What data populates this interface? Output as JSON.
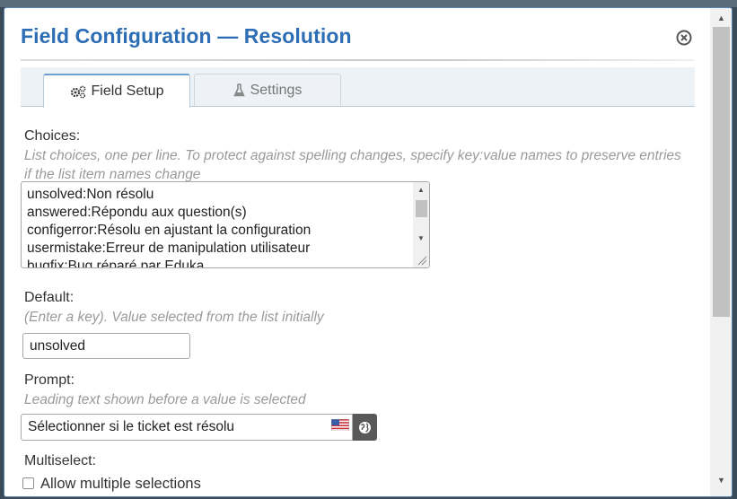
{
  "dialog": {
    "title": "Field Configuration — Resolution"
  },
  "tabs": [
    {
      "label": "Field Setup",
      "icon": "gears-icon",
      "active": true
    },
    {
      "label": "Settings",
      "icon": "flask-icon",
      "active": false
    }
  ],
  "choices": {
    "label": "Choices:",
    "hint": "List choices, one per line. To protect against spelling changes, specify key:value names to preserve entries if the list item names change",
    "value": "unsolved:Non résolu\nanswered:Répondu aux question(s)\nconfigerror:Résolu en ajustant la configuration\nusermistake:Erreur de manipulation utilisateur\nbugfix:Bug réparé par Eduka"
  },
  "default": {
    "label": "Default:",
    "hint": "(Enter a key). Value selected from the list initially",
    "value": "unsolved"
  },
  "prompt": {
    "label": "Prompt:",
    "hint": "Leading text shown before a value is selected",
    "value": "Sélectionner si le ticket est résolu",
    "flag_icon": "us-flag-icon",
    "globe_icon": "globe-icon"
  },
  "multiselect": {
    "label": "Multiselect:",
    "checkbox_label": "Allow multiple selections",
    "checked": false
  },
  "colors": {
    "title": "#2c6db4",
    "hint": "#9a9a9a",
    "tab_active_border": "#6fa0cf"
  }
}
